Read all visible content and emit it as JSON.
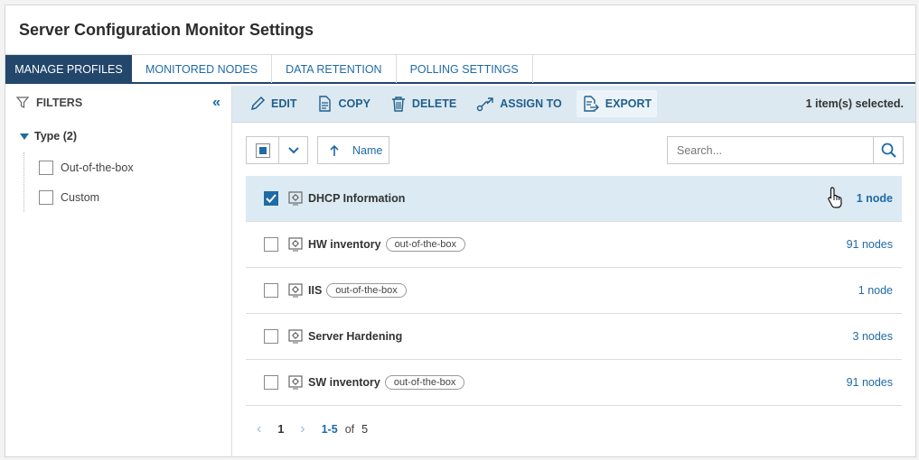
{
  "window": {
    "title": "Server Configuration Monitor Settings"
  },
  "tabs": [
    {
      "label": "MANAGE PROFILES"
    },
    {
      "label": "MONITORED NODES"
    },
    {
      "label": "DATA RETENTION"
    },
    {
      "label": "POLLING SETTINGS"
    }
  ],
  "filters": {
    "title": "FILTERS",
    "group": "Type (2)",
    "items": [
      {
        "label": "Out-of-the-box"
      },
      {
        "label": "Custom"
      }
    ]
  },
  "toolbar": {
    "edit": "EDIT",
    "copy": "COPY",
    "delete": "DELETE",
    "assign": "ASSIGN TO",
    "export": "EXPORT",
    "selected": "1 item(s) selected."
  },
  "controls": {
    "sort_label": "Name",
    "search_placeholder": "Search..."
  },
  "rows": [
    {
      "name": "DHCP Information",
      "badge": "",
      "nodes": "1 node",
      "checked": true
    },
    {
      "name": "HW inventory",
      "badge": "out-of-the-box",
      "nodes": "91 nodes",
      "checked": false
    },
    {
      "name": "IIS",
      "badge": "out-of-the-box",
      "nodes": "1 node",
      "checked": false
    },
    {
      "name": "Server Hardening",
      "badge": "",
      "nodes": "3 nodes",
      "checked": false
    },
    {
      "name": "SW inventory",
      "badge": "out-of-the-box",
      "nodes": "91 nodes",
      "checked": false
    }
  ],
  "pager": {
    "current": "1",
    "range": "1-5",
    "of": "of",
    "total": "5"
  },
  "colors": {
    "accent": "#1f6ba6",
    "nav": "#23466b",
    "toolbar_bg": "#dce9f1"
  }
}
